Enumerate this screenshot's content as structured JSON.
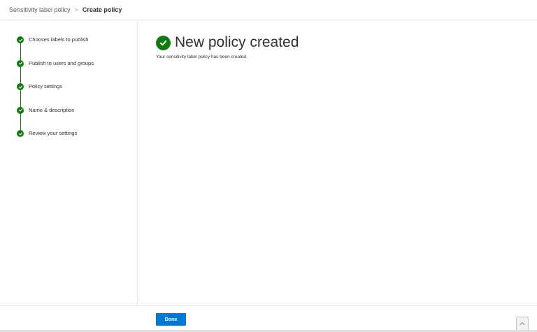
{
  "breadcrumb": {
    "parent": "Sensitivity label policy",
    "separator": ">",
    "current": "Create policy"
  },
  "wizard": {
    "steps": [
      {
        "label": "Chooses labels to publish",
        "status": "complete"
      },
      {
        "label": "Publish to users and groups",
        "status": "complete"
      },
      {
        "label": "Policy settings",
        "status": "complete"
      },
      {
        "label": "Name & description",
        "status": "complete"
      },
      {
        "label": "Review your settings",
        "status": "complete"
      }
    ]
  },
  "main": {
    "title": "New policy created",
    "subtitle": "Your sensitivity label policy has been created."
  },
  "footer": {
    "done_label": "Done"
  },
  "icons": {
    "step": "check-circle-icon",
    "title": "check-circle-icon",
    "scroll_top": "chevron-up-icon"
  },
  "colors": {
    "success": "#107c10",
    "primary": "#0078d4"
  }
}
